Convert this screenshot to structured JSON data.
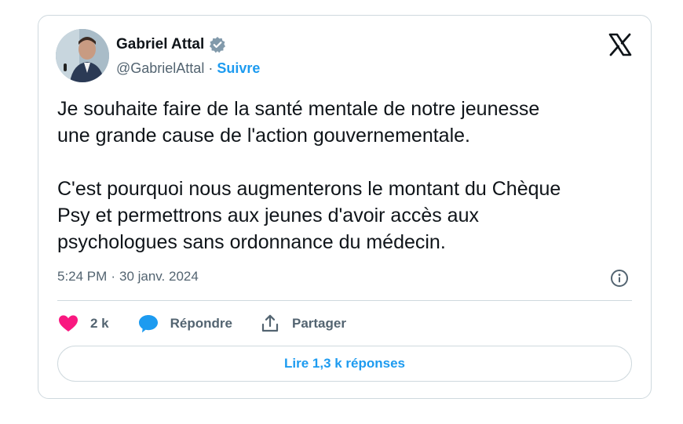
{
  "author": {
    "name": "Gabriel Attal",
    "handle": "@GabrielAttal",
    "separator": "·",
    "follow_label": "Suivre"
  },
  "tweet": {
    "text": "Je souhaite faire de la santé mentale de notre jeunesse\nune grande cause de l'action gouvernementale.\n\nC'est pourquoi nous augmenterons le montant du Chèque\nPsy et permettrons aux jeunes d'avoir accès aux\npsychologues sans ordonnance du médecin.",
    "time": "5:24 PM",
    "separator": "·",
    "date": "30 janv. 2024"
  },
  "actions": {
    "like_count": "2 k",
    "reply_label": "Répondre",
    "share_label": "Partager",
    "read_replies_label": "Lire 1,3 k réponses"
  },
  "colors": {
    "accent": "#1d9bf0",
    "like": "#f91880",
    "text": "#0f1419",
    "muted": "#536471",
    "border": "#cfd9de"
  },
  "icons": [
    "verified-badge-icon",
    "x-logo-icon",
    "info-icon",
    "heart-icon",
    "reply-bubble-icon",
    "share-icon"
  ]
}
